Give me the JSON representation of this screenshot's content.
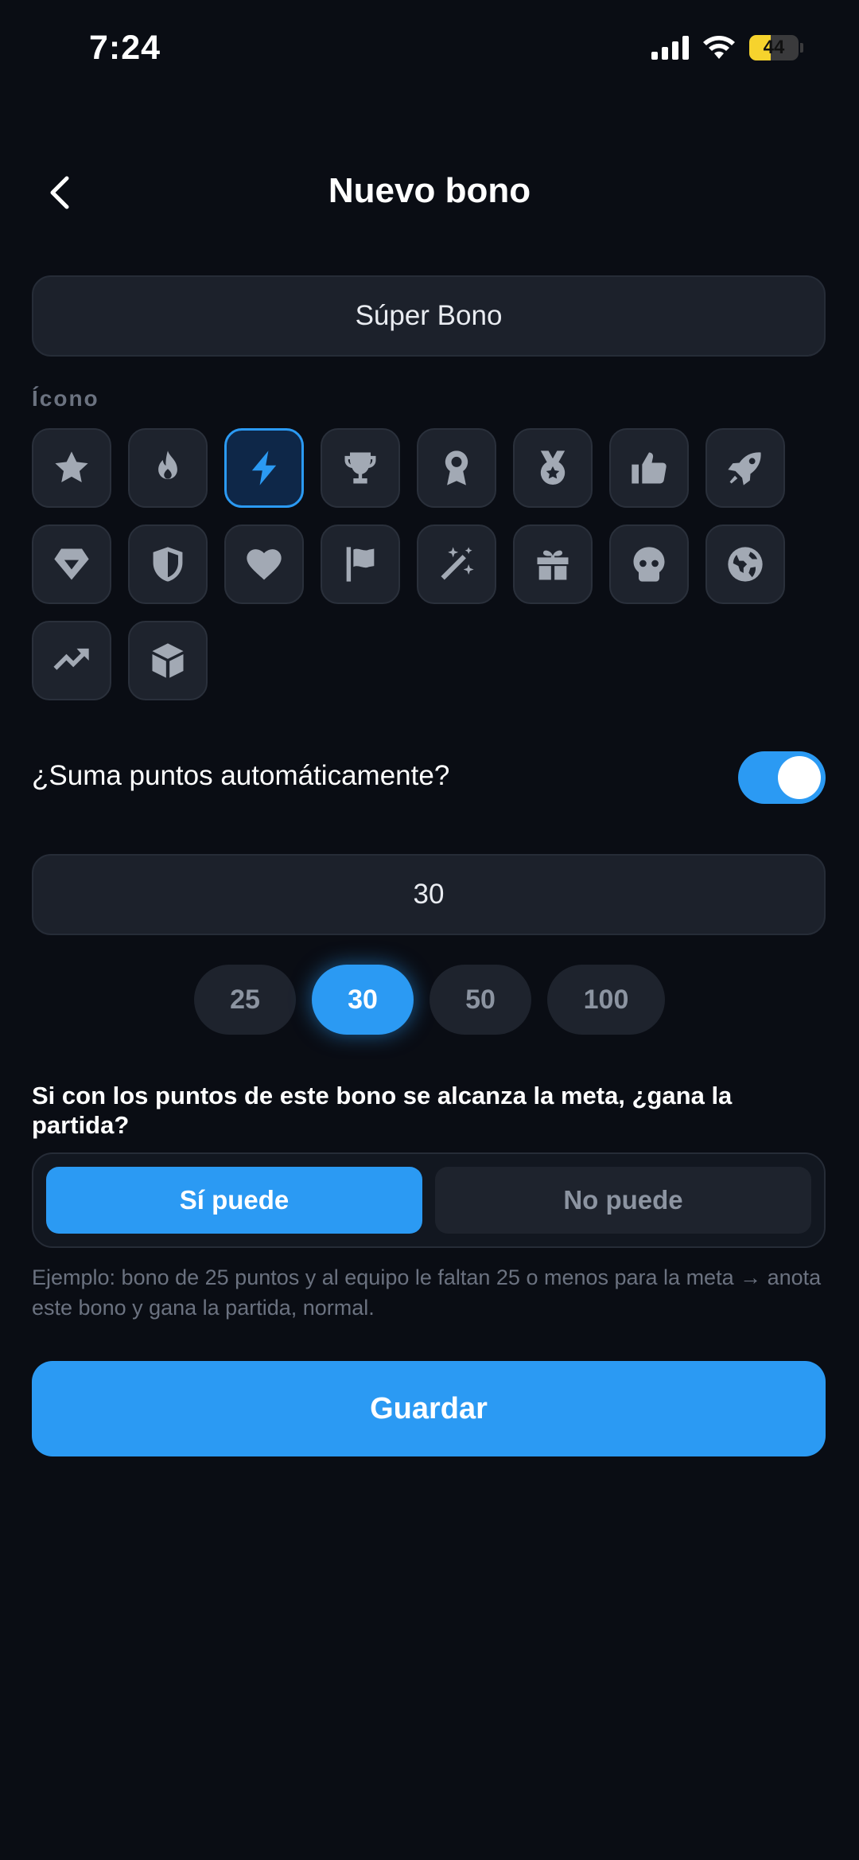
{
  "status_bar": {
    "time": "7:24",
    "battery": "44"
  },
  "header": {
    "title": "Nuevo bono"
  },
  "name_field": {
    "value": "Súper Bono"
  },
  "icon_section": {
    "label": "Ícono",
    "icons": [
      "star",
      "flame",
      "bolt",
      "trophy",
      "award",
      "medal",
      "thumbs-up",
      "rocket",
      "gem",
      "shield",
      "heart",
      "flag",
      "magic-wand",
      "gift",
      "skull",
      "globe",
      "trending-up",
      "cube"
    ],
    "selected": "bolt"
  },
  "auto_points": {
    "label": "¿Suma puntos automáticamente?",
    "enabled": true
  },
  "points_field": {
    "value": "30"
  },
  "quick_values": [
    "25",
    "30",
    "50",
    "100"
  ],
  "quick_selected": "30",
  "win_question": {
    "text": "Si con los puntos de este bono se alcanza la meta, ¿gana la partida?",
    "option_yes": "Sí puede",
    "option_no": "No puede",
    "selected": "Sí puede"
  },
  "hint": "Ejemplo: bono de 25 puntos y al equipo le faltan 25 o menos para la meta → anota este bono y gana la partida, normal.",
  "save_label": "Guardar",
  "colors": {
    "accent": "#2b9af3",
    "background": "#0a0d14",
    "surface": "#1c212b"
  }
}
